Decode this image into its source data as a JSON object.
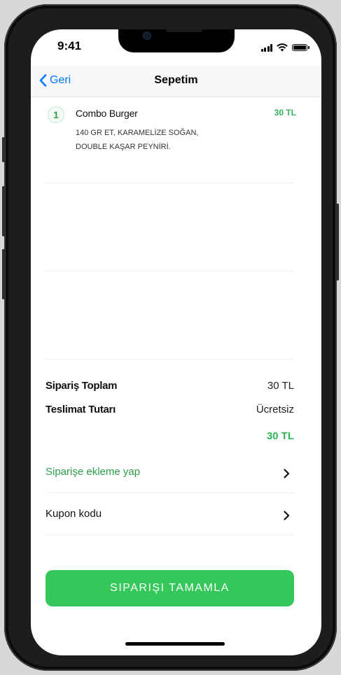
{
  "status": {
    "time": "9:41"
  },
  "nav": {
    "back_label": "Geri",
    "title": "Sepetim"
  },
  "cart": {
    "items": [
      {
        "quantity": "1",
        "name": "Combo Burger",
        "price": "30 TL",
        "description_line1": "140 GR ET, KARAMELİZE SOĞAN,",
        "description_line2": "DOUBLE KAŞAR PEYNİRİ."
      }
    ]
  },
  "summary": {
    "order_total_label": "Sipariş Toplam",
    "order_total_value": "30 TL",
    "delivery_label": "Teslimat Tutarı",
    "delivery_value": "Ücretsiz",
    "grand_total": "30 TL"
  },
  "links": {
    "add_to_order": "Siparişe ekleme yap",
    "coupon": "Kupon kodu"
  },
  "cta": {
    "label": "SIPARIŞI TAMAMLA"
  },
  "colors": {
    "accent_green": "#34c759",
    "link_green": "#2e9e4b",
    "ios_blue": "#007aff"
  }
}
